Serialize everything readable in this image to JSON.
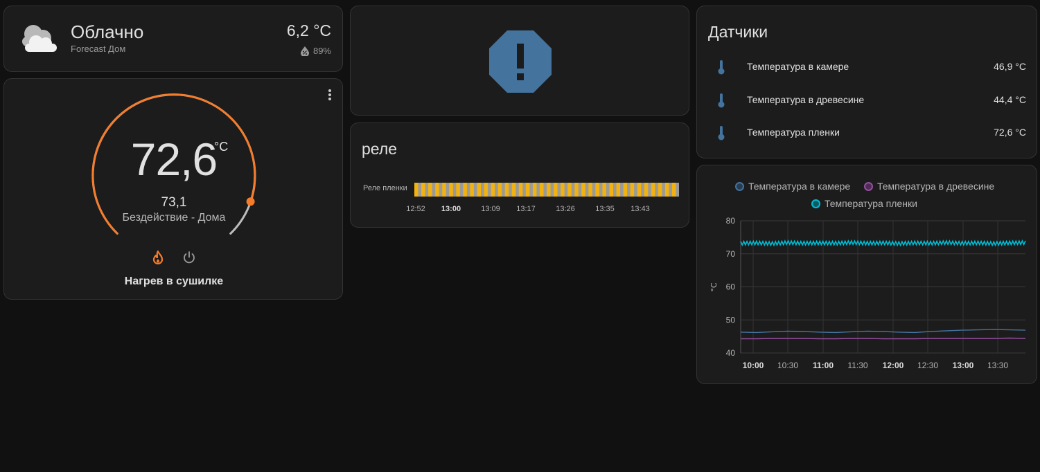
{
  "weather": {
    "condition": "Облачно",
    "location": "Forecast Дом",
    "temperature": "6,2 °C",
    "humidity": "89%"
  },
  "thermostat": {
    "current_value": "72,6",
    "unit": "°C",
    "target": "73,1",
    "mode": "Бездействие - Дома",
    "name": "Нагрев в сушилке",
    "accent": "#f57c2a"
  },
  "alert": {
    "icon": "alert-octagon-icon",
    "color": "#44739e"
  },
  "relay": {
    "title": "реле",
    "series_label": "Реле пленки",
    "ticks": [
      {
        "label": "12:52",
        "bold": false
      },
      {
        "label": "13:00",
        "bold": true
      },
      {
        "label": "13:09",
        "bold": false
      },
      {
        "label": "13:17",
        "bold": false
      },
      {
        "label": "13:26",
        "bold": false
      },
      {
        "label": "13:35",
        "bold": false
      },
      {
        "label": "13:43",
        "bold": false
      }
    ],
    "on_color": "#f2b20f",
    "off_color": "#9a9a9a",
    "segments": 38
  },
  "sensors": {
    "title": "Датчики",
    "items": [
      {
        "name": "Температура в камере",
        "value": "46,9 °C"
      },
      {
        "name": "Температура в древесине",
        "value": "44,4 °C"
      },
      {
        "name": "Температура пленки",
        "value": "72,6 °C"
      }
    ]
  },
  "chart_data": {
    "type": "line",
    "ylabel": "°C",
    "ylim": [
      40,
      80
    ],
    "yticks": [
      "80",
      "70",
      "60",
      "50",
      "40"
    ],
    "xticks": [
      {
        "label": "10:00",
        "bold": true
      },
      {
        "label": "10:30",
        "bold": false
      },
      {
        "label": "11:00",
        "bold": true
      },
      {
        "label": "11:30",
        "bold": false
      },
      {
        "label": "12:00",
        "bold": true
      },
      {
        "label": "12:30",
        "bold": false
      },
      {
        "label": "13:00",
        "bold": true
      },
      {
        "label": "13:30",
        "bold": false
      }
    ],
    "grid": true,
    "legend_position": "top",
    "series": [
      {
        "name": "Температура в камере",
        "color": "#44739e",
        "values": [
          46.3,
          46.2,
          46.4,
          46.6,
          46.5,
          46.3,
          46.2,
          46.4,
          46.6,
          46.5,
          46.3,
          46.2,
          46.5,
          46.7,
          46.9,
          47.0,
          47.1,
          47.0,
          46.9
        ]
      },
      {
        "name": "Температура в древесине",
        "color": "#984ea3",
        "values": [
          44.3,
          44.3,
          44.4,
          44.4,
          44.4,
          44.3,
          44.3,
          44.4,
          44.4,
          44.3,
          44.3,
          44.3,
          44.4,
          44.4,
          44.4,
          44.4,
          44.4,
          44.5,
          44.4
        ]
      },
      {
        "name": "Температура пленки",
        "color": "#00bcd4",
        "values": [
          73.2,
          73.3,
          73.1,
          73.4,
          73.2,
          73.3,
          73.2,
          73.4,
          73.2,
          73.3,
          73.1,
          73.3,
          73.2,
          73.4,
          73.2,
          73.3,
          73.1,
          73.3,
          73.4
        ]
      }
    ]
  }
}
